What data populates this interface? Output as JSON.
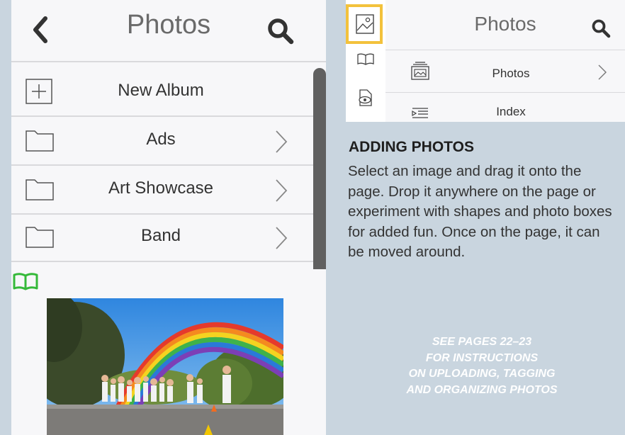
{
  "left_panel": {
    "title": "Photos",
    "rows": [
      {
        "label": "New Album",
        "icon": "plus-square-icon"
      },
      {
        "label": "Ads",
        "icon": "folder-icon"
      },
      {
        "label": "Art Showcase",
        "icon": "folder-icon"
      },
      {
        "label": "Band",
        "icon": "folder-icon"
      }
    ]
  },
  "right_panel": {
    "title": "Photos",
    "rows": [
      {
        "label": "Photos",
        "icon": "photos-stack-icon"
      },
      {
        "label": "Index",
        "icon": "index-list-icon"
      }
    ]
  },
  "instructions": {
    "heading": "ADDING PHOTOS",
    "body": "Select an image and drag it onto the page. Drop it anywhere on the page or experiment with shapes and photo boxes for added fun. Once on the page, it can be moved around.",
    "note_lines": [
      "SEE PAGES 22–23",
      "FOR INSTRUCTIONS",
      "ON UPLOADING, TAGGING",
      "AND ORGANIZING PHOTOS"
    ]
  },
  "colors": {
    "accent_book": "#35b93a",
    "highlight_border": "#f3c23c",
    "background": "#c9d5df"
  }
}
